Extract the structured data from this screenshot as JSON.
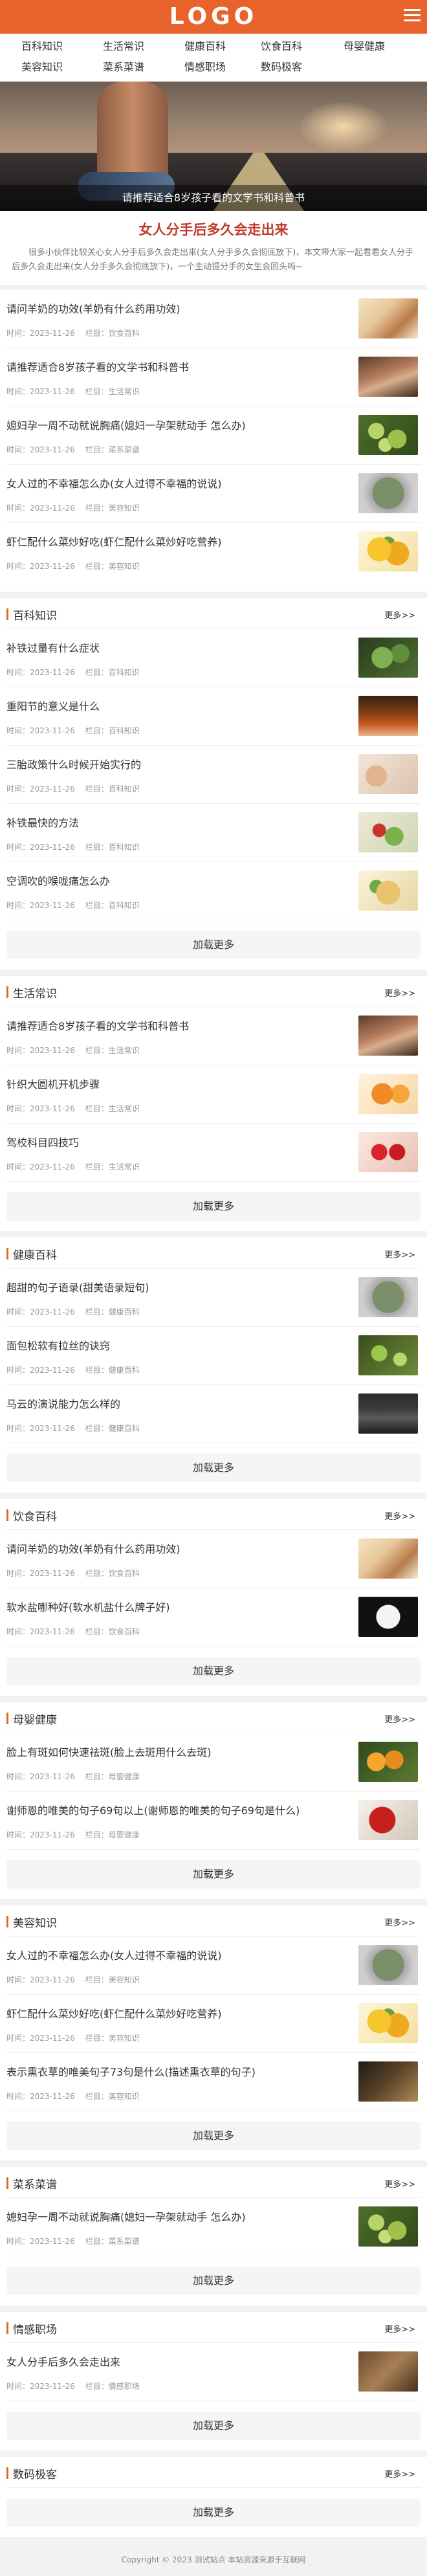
{
  "header": {
    "logo": "LOGO"
  },
  "nav": {
    "row1": [
      "百科知识",
      "生活常识",
      "健康百科",
      "饮食百科",
      "母婴健康"
    ],
    "row2": [
      "美容知识",
      "菜系菜谱",
      "情感职场",
      "数码极客"
    ]
  },
  "hero": {
    "caption": "请推荐适合8岁孩子看的文学书和科普书"
  },
  "intro": {
    "title": "女人分手后多久会走出来",
    "text": "很多小伙伴比较关心女人分手后多久会走出来(女人分手多久会彻底放下)，本文带大家一起看看女人分手后多久会走出来(女人分手多久会彻底放下)，一个主动提分手的女生会回头吗~"
  },
  "meta_labels": {
    "time": "时间：",
    "column": "栏目："
  },
  "top_list": [
    {
      "title": "请问羊奶的功效(羊奶有什么药用功效)",
      "date": "2023-11-26",
      "column": "饮食百科"
    },
    {
      "title": "请推荐适合8岁孩子看的文学书和科普书",
      "date": "2023-11-26",
      "column": "生活常识"
    },
    {
      "title": "媳妇孕一周不动就说胸痛(媳妇一孕架就动手 怎么办)",
      "date": "2023-11-26",
      "column": "菜系菜谱"
    },
    {
      "title": "女人过的不幸福怎么办(女人过得不幸福的说说)",
      "date": "2023-11-26",
      "column": "美容知识"
    },
    {
      "title": "虾仁配什么菜炒好吃(虾仁配什么菜炒好吃营养)",
      "date": "2023-11-26",
      "column": "美容知识"
    }
  ],
  "more_label": "更多>>",
  "load_more_label": "加载更多",
  "sections": [
    {
      "name": "百科知识",
      "items": [
        {
          "title": "补铁过量有什么症状",
          "date": "2023-11-26",
          "column": "百科知识"
        },
        {
          "title": "重阳节的意义是什么",
          "date": "2023-11-26",
          "column": "百科知识"
        },
        {
          "title": "三胎政策什么时候开始实行的",
          "date": "2023-11-26",
          "column": "百科知识"
        },
        {
          "title": "补铁最快的方法",
          "date": "2023-11-26",
          "column": "百科知识"
        },
        {
          "title": "空调吹的喉咙痛怎么办",
          "date": "2023-11-26",
          "column": "百科知识"
        }
      ]
    },
    {
      "name": "生活常识",
      "items": [
        {
          "title": "请推荐适合8岁孩子看的文学书和科普书",
          "date": "2023-11-26",
          "column": "生活常识"
        },
        {
          "title": "针织大圆机开机步骤",
          "date": "2023-11-26",
          "column": "生活常识"
        },
        {
          "title": "驾校科目四技巧",
          "date": "2023-11-26",
          "column": "生活常识"
        }
      ]
    },
    {
      "name": "健康百科",
      "items": [
        {
          "title": "超甜的句子语录(甜美语录短句)",
          "date": "2023-11-26",
          "column": "健康百科"
        },
        {
          "title": "面包松软有拉丝的诀窍",
          "date": "2023-11-26",
          "column": "健康百科"
        },
        {
          "title": "马云的演说能力怎么样的",
          "date": "2023-11-26",
          "column": "健康百科"
        }
      ]
    },
    {
      "name": "饮食百科",
      "items": [
        {
          "title": "请问羊奶的功效(羊奶有什么药用功效)",
          "date": "2023-11-26",
          "column": "饮食百科"
        },
        {
          "title": "软水盐哪种好(软水机盐什么牌子好)",
          "date": "2023-11-26",
          "column": "饮食百科"
        }
      ]
    },
    {
      "name": "母婴健康",
      "items": [
        {
          "title": "脸上有斑如何快速祛斑(脸上去斑用什么去斑)",
          "date": "2023-11-26",
          "column": "母婴健康"
        },
        {
          "title": "谢师恩的唯美的句子69句以上(谢师恩的唯美的句子69句是什么)",
          "date": "2023-11-26",
          "column": "母婴健康"
        }
      ]
    },
    {
      "name": "美容知识",
      "items": [
        {
          "title": "女人过的不幸福怎么办(女人过得不幸福的说说)",
          "date": "2023-11-26",
          "column": "美容知识"
        },
        {
          "title": "虾仁配什么菜炒好吃(虾仁配什么菜炒好吃营养)",
          "date": "2023-11-26",
          "column": "美容知识"
        },
        {
          "title": "表示熏衣草的唯美句子73句是什么(描述熏衣草的句子)",
          "date": "2023-11-26",
          "column": "美容知识"
        }
      ]
    },
    {
      "name": "菜系菜谱",
      "items": [
        {
          "title": "媳妇孕一周不动就说胸痛(媳妇一孕架就动手 怎么办)",
          "date": "2023-11-26",
          "column": "菜系菜谱"
        }
      ]
    },
    {
      "name": "情感职场",
      "items": [
        {
          "title": "女人分手后多久会走出来",
          "date": "2023-11-26",
          "column": "情感职场"
        }
      ]
    },
    {
      "name": "数码极客",
      "items": []
    }
  ],
  "footer": {
    "text": "Copyright © 2023 测试站点 本站资源来源于互联网"
  }
}
